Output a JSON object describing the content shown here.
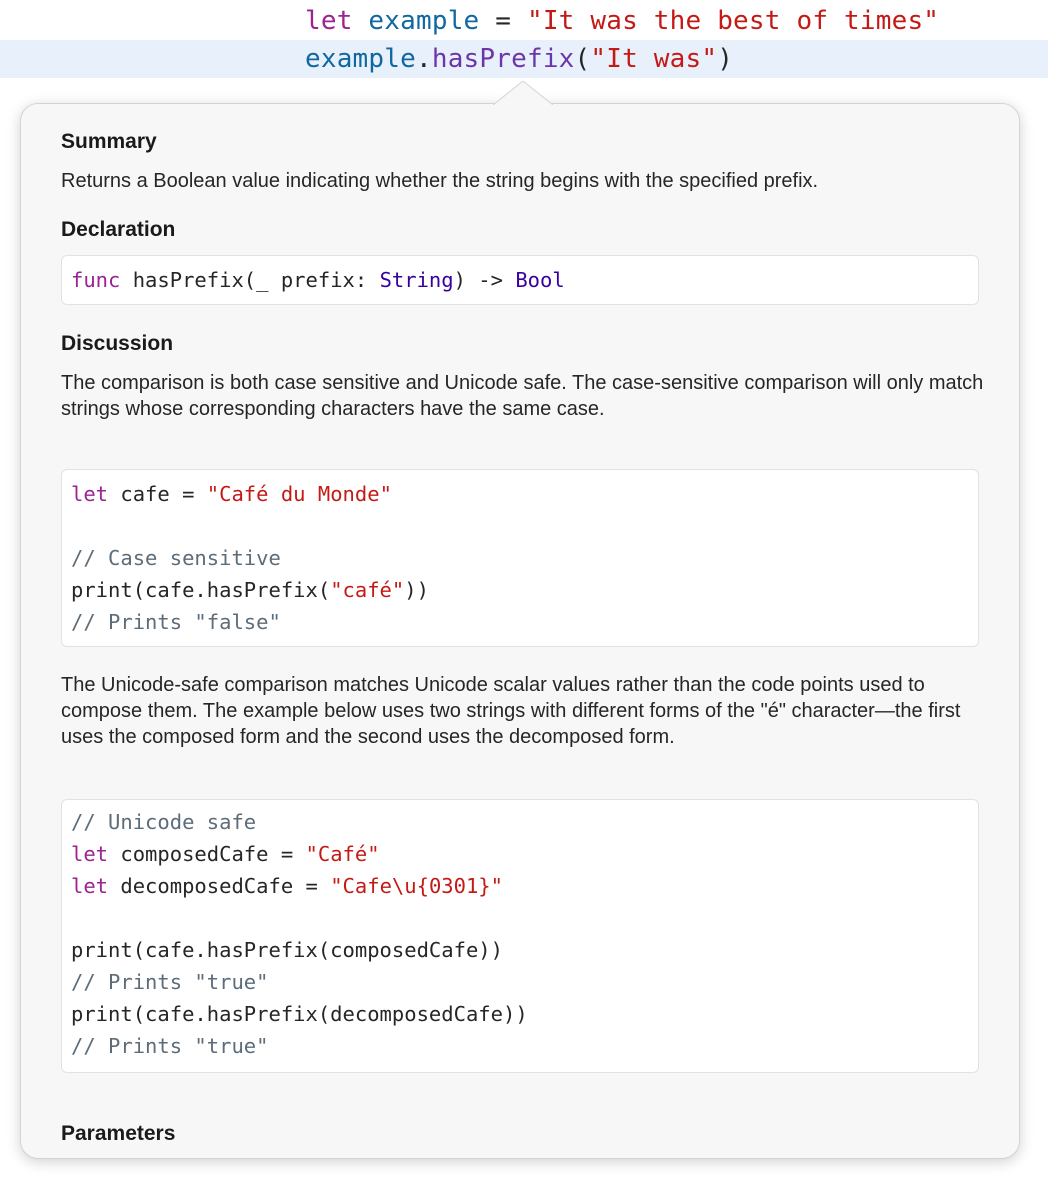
{
  "editor": {
    "line1": {
      "keyword": "let",
      "name": "example",
      "op": " = ",
      "string": "\"It was the best of times\""
    },
    "line2": {
      "receiver": "example",
      "dot": ".",
      "method": "hasPrefix",
      "open": "(",
      "string": "\"It was\"",
      "close": ")"
    }
  },
  "popover": {
    "summary_heading": "Summary",
    "summary_text": "Returns a Boolean value indicating whether the string begins with the specified prefix.",
    "declaration_heading": "Declaration",
    "declaration": {
      "keyword": "func",
      "signature": " hasPrefix(_ prefix: ",
      "param_type": "String",
      "arrow": ") -> ",
      "return_type": "Bool"
    },
    "discussion_heading": "Discussion",
    "discussion_text_1": "The comparison is both case sensitive and Unicode safe. The case-sensitive comparison will only match strings whose corresponding characters have the same case.",
    "code1": {
      "l1_kw": "let",
      "l1_rest": " cafe = ",
      "l1_str": "\"Café du Monde\"",
      "l2_comment": "// Case sensitive",
      "l3_code": "print(cafe.hasPrefix(",
      "l3_str": "\"café\"",
      "l3_close": "))",
      "l4_comment": "// Prints \"false\""
    },
    "discussion_text_2": "The Unicode-safe comparison matches Unicode scalar values rather than the code points used to compose them. The example below uses two strings with different forms of the \"é\" character—the first uses the composed form and the second uses the decomposed form.",
    "code2": {
      "l1_comment": "// Unicode safe",
      "l2_kw": "let",
      "l2_rest": " composedCafe = ",
      "l2_str": "\"Café\"",
      "l3_kw": "let",
      "l3_rest": " decomposedCafe = ",
      "l3_str": "\"Cafe\\u{0301}\"",
      "l4_code": "print(cafe.hasPrefix(composedCafe))",
      "l5_comment": "// Prints \"true\"",
      "l6_code": "print(cafe.hasPrefix(decomposedCafe))",
      "l7_comment": "// Prints \"true\""
    },
    "parameters_heading": "Parameters"
  },
  "colors": {
    "keyword": "#9b2393",
    "identifier": "#0f68a0",
    "method": "#6c36a9",
    "string": "#c41a16",
    "type": "#3900a0",
    "comment": "#5d6c79",
    "current_line_highlight": "#e8f0fb",
    "popover_background": "#f7f7f7"
  }
}
